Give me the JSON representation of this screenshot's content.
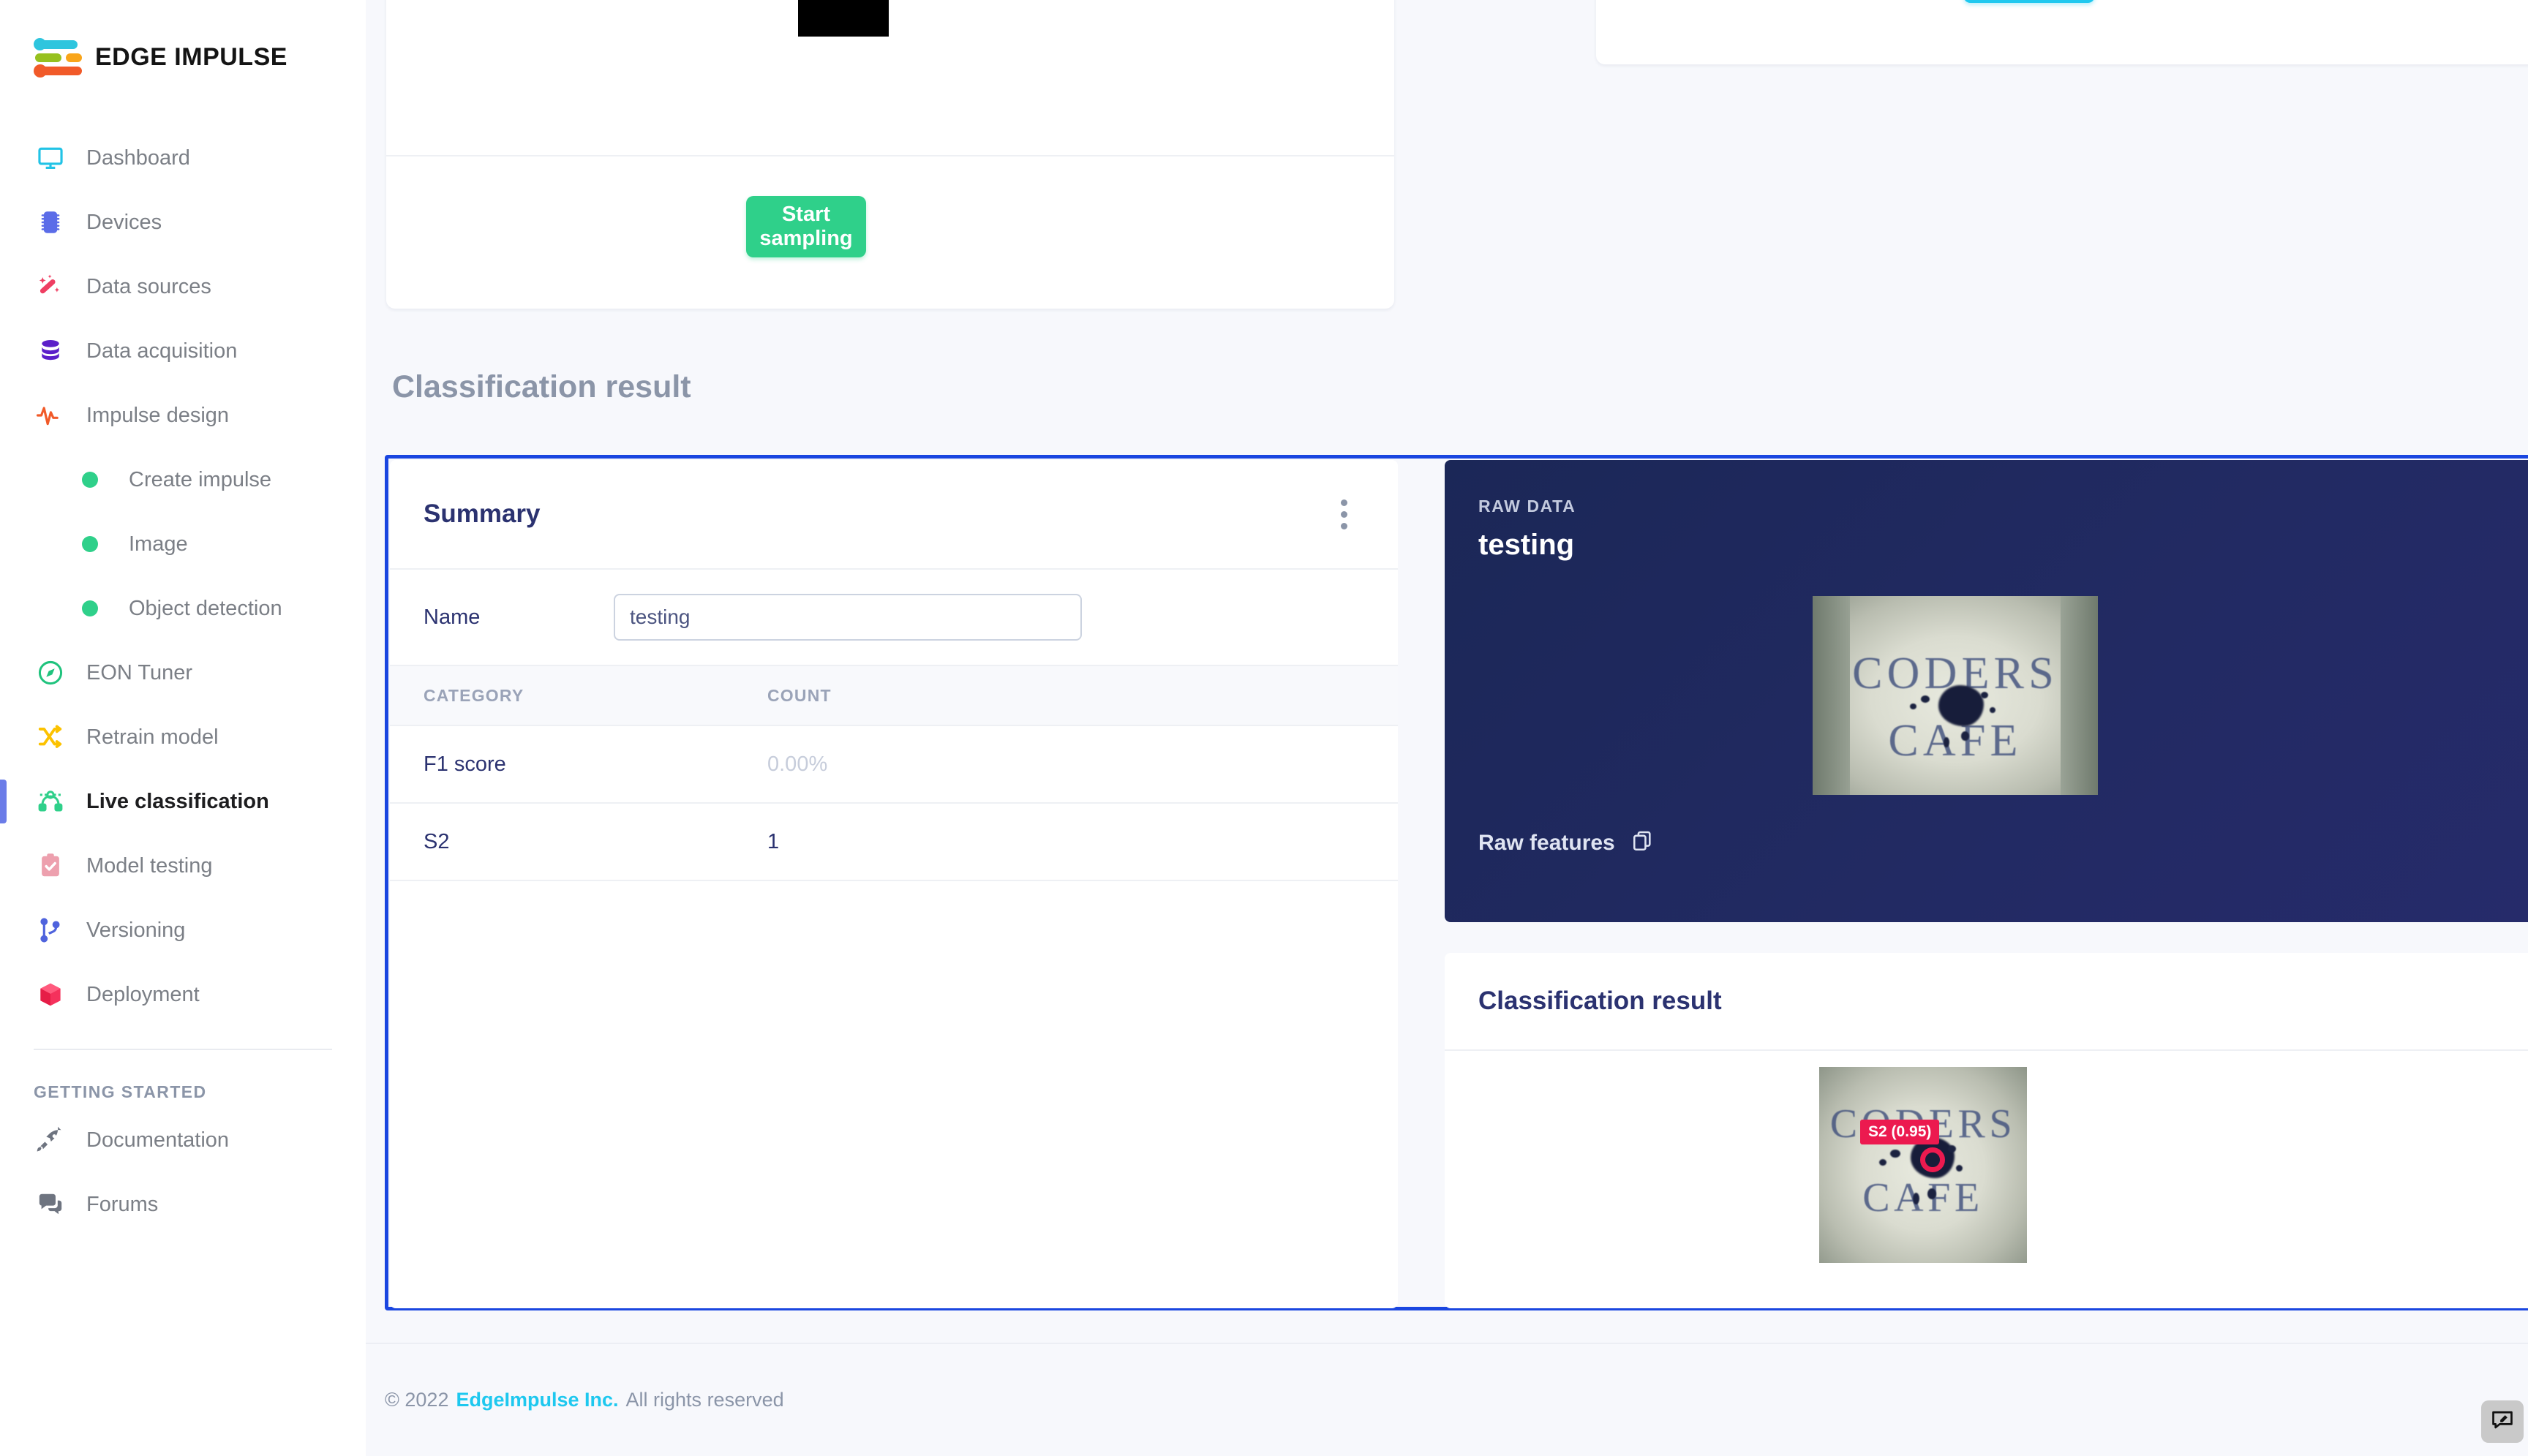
{
  "brand": {
    "name": "EDGE IMPULSE"
  },
  "sidebar": {
    "items": [
      {
        "label": "Dashboard",
        "icon": "monitor-icon"
      },
      {
        "label": "Devices",
        "icon": "chip-icon"
      },
      {
        "label": "Data sources",
        "icon": "wand-icon"
      },
      {
        "label": "Data acquisition",
        "icon": "database-icon"
      },
      {
        "label": "Impulse design",
        "icon": "pulse-icon"
      }
    ],
    "sub_items": [
      {
        "label": "Create impulse"
      },
      {
        "label": "Image"
      },
      {
        "label": "Object detection"
      }
    ],
    "items2": [
      {
        "label": "EON Tuner",
        "icon": "compass-icon"
      },
      {
        "label": "Retrain model",
        "icon": "shuffle-icon"
      },
      {
        "label": "Live classification",
        "icon": "nodes-icon",
        "active": true
      },
      {
        "label": "Model testing",
        "icon": "clipboard-check-icon"
      },
      {
        "label": "Versioning",
        "icon": "git-branch-icon"
      },
      {
        "label": "Deployment",
        "icon": "box-icon"
      }
    ],
    "section_title": "GETTING STARTED",
    "items3": [
      {
        "label": "Documentation",
        "icon": "rocket-icon"
      },
      {
        "label": "Forums",
        "icon": "chat-icon"
      }
    ]
  },
  "top": {
    "start_sampling_label": "Start sampling"
  },
  "page": {
    "section_title": "Classification result"
  },
  "summary": {
    "title": "Summary",
    "name_label": "Name",
    "name_value": "testing",
    "name_placeholder": "Name",
    "table": {
      "headers": [
        "CATEGORY",
        "COUNT"
      ],
      "rows": [
        {
          "category": "F1 score",
          "count": "0.00%",
          "muted": true
        },
        {
          "category": "S2",
          "count": "1",
          "muted": false
        }
      ]
    }
  },
  "raw_data": {
    "kicker": "RAW DATA",
    "title": "testing",
    "raw_features_label": "Raw features",
    "image_text": {
      "line1": "CODERS",
      "line2": "CAFE"
    }
  },
  "classification_result": {
    "title": "Classification result",
    "detection_label": "S2 (0.95)",
    "image_text": {
      "line1": "CODERS",
      "line2": "CAFE"
    }
  },
  "footer": {
    "copyright": "© 2022",
    "brand": "EdgeImpulse Inc.",
    "rights": "All rights reserved"
  },
  "colors": {
    "accent_green": "#2fd08a",
    "accent_cyan": "#1ec8ef",
    "selection_blue": "#1a46e0",
    "detection_red": "#ec1a4f",
    "dark_panel": "#1b2757",
    "active_indicator": "#6b7ce8"
  }
}
